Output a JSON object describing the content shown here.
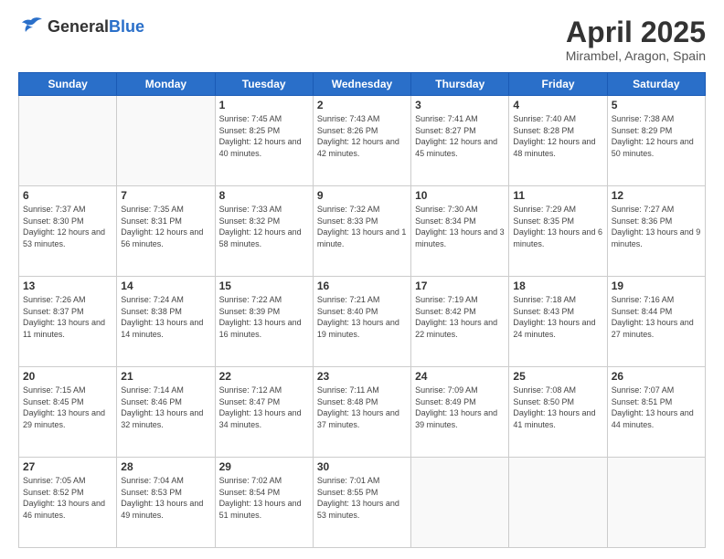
{
  "header": {
    "logo_general": "General",
    "logo_blue": "Blue",
    "title": "April 2025",
    "location": "Mirambel, Aragon, Spain"
  },
  "weekdays": [
    "Sunday",
    "Monday",
    "Tuesday",
    "Wednesday",
    "Thursday",
    "Friday",
    "Saturday"
  ],
  "rows": [
    [
      {
        "day": "",
        "info": ""
      },
      {
        "day": "",
        "info": ""
      },
      {
        "day": "1",
        "info": "Sunrise: 7:45 AM\nSunset: 8:25 PM\nDaylight: 12 hours and 40 minutes."
      },
      {
        "day": "2",
        "info": "Sunrise: 7:43 AM\nSunset: 8:26 PM\nDaylight: 12 hours and 42 minutes."
      },
      {
        "day": "3",
        "info": "Sunrise: 7:41 AM\nSunset: 8:27 PM\nDaylight: 12 hours and 45 minutes."
      },
      {
        "day": "4",
        "info": "Sunrise: 7:40 AM\nSunset: 8:28 PM\nDaylight: 12 hours and 48 minutes."
      },
      {
        "day": "5",
        "info": "Sunrise: 7:38 AM\nSunset: 8:29 PM\nDaylight: 12 hours and 50 minutes."
      }
    ],
    [
      {
        "day": "6",
        "info": "Sunrise: 7:37 AM\nSunset: 8:30 PM\nDaylight: 12 hours and 53 minutes."
      },
      {
        "day": "7",
        "info": "Sunrise: 7:35 AM\nSunset: 8:31 PM\nDaylight: 12 hours and 56 minutes."
      },
      {
        "day": "8",
        "info": "Sunrise: 7:33 AM\nSunset: 8:32 PM\nDaylight: 12 hours and 58 minutes."
      },
      {
        "day": "9",
        "info": "Sunrise: 7:32 AM\nSunset: 8:33 PM\nDaylight: 13 hours and 1 minute."
      },
      {
        "day": "10",
        "info": "Sunrise: 7:30 AM\nSunset: 8:34 PM\nDaylight: 13 hours and 3 minutes."
      },
      {
        "day": "11",
        "info": "Sunrise: 7:29 AM\nSunset: 8:35 PM\nDaylight: 13 hours and 6 minutes."
      },
      {
        "day": "12",
        "info": "Sunrise: 7:27 AM\nSunset: 8:36 PM\nDaylight: 13 hours and 9 minutes."
      }
    ],
    [
      {
        "day": "13",
        "info": "Sunrise: 7:26 AM\nSunset: 8:37 PM\nDaylight: 13 hours and 11 minutes."
      },
      {
        "day": "14",
        "info": "Sunrise: 7:24 AM\nSunset: 8:38 PM\nDaylight: 13 hours and 14 minutes."
      },
      {
        "day": "15",
        "info": "Sunrise: 7:22 AM\nSunset: 8:39 PM\nDaylight: 13 hours and 16 minutes."
      },
      {
        "day": "16",
        "info": "Sunrise: 7:21 AM\nSunset: 8:40 PM\nDaylight: 13 hours and 19 minutes."
      },
      {
        "day": "17",
        "info": "Sunrise: 7:19 AM\nSunset: 8:42 PM\nDaylight: 13 hours and 22 minutes."
      },
      {
        "day": "18",
        "info": "Sunrise: 7:18 AM\nSunset: 8:43 PM\nDaylight: 13 hours and 24 minutes."
      },
      {
        "day": "19",
        "info": "Sunrise: 7:16 AM\nSunset: 8:44 PM\nDaylight: 13 hours and 27 minutes."
      }
    ],
    [
      {
        "day": "20",
        "info": "Sunrise: 7:15 AM\nSunset: 8:45 PM\nDaylight: 13 hours and 29 minutes."
      },
      {
        "day": "21",
        "info": "Sunrise: 7:14 AM\nSunset: 8:46 PM\nDaylight: 13 hours and 32 minutes."
      },
      {
        "day": "22",
        "info": "Sunrise: 7:12 AM\nSunset: 8:47 PM\nDaylight: 13 hours and 34 minutes."
      },
      {
        "day": "23",
        "info": "Sunrise: 7:11 AM\nSunset: 8:48 PM\nDaylight: 13 hours and 37 minutes."
      },
      {
        "day": "24",
        "info": "Sunrise: 7:09 AM\nSunset: 8:49 PM\nDaylight: 13 hours and 39 minutes."
      },
      {
        "day": "25",
        "info": "Sunrise: 7:08 AM\nSunset: 8:50 PM\nDaylight: 13 hours and 41 minutes."
      },
      {
        "day": "26",
        "info": "Sunrise: 7:07 AM\nSunset: 8:51 PM\nDaylight: 13 hours and 44 minutes."
      }
    ],
    [
      {
        "day": "27",
        "info": "Sunrise: 7:05 AM\nSunset: 8:52 PM\nDaylight: 13 hours and 46 minutes."
      },
      {
        "day": "28",
        "info": "Sunrise: 7:04 AM\nSunset: 8:53 PM\nDaylight: 13 hours and 49 minutes."
      },
      {
        "day": "29",
        "info": "Sunrise: 7:02 AM\nSunset: 8:54 PM\nDaylight: 13 hours and 51 minutes."
      },
      {
        "day": "30",
        "info": "Sunrise: 7:01 AM\nSunset: 8:55 PM\nDaylight: 13 hours and 53 minutes."
      },
      {
        "day": "",
        "info": ""
      },
      {
        "day": "",
        "info": ""
      },
      {
        "day": "",
        "info": ""
      }
    ]
  ]
}
